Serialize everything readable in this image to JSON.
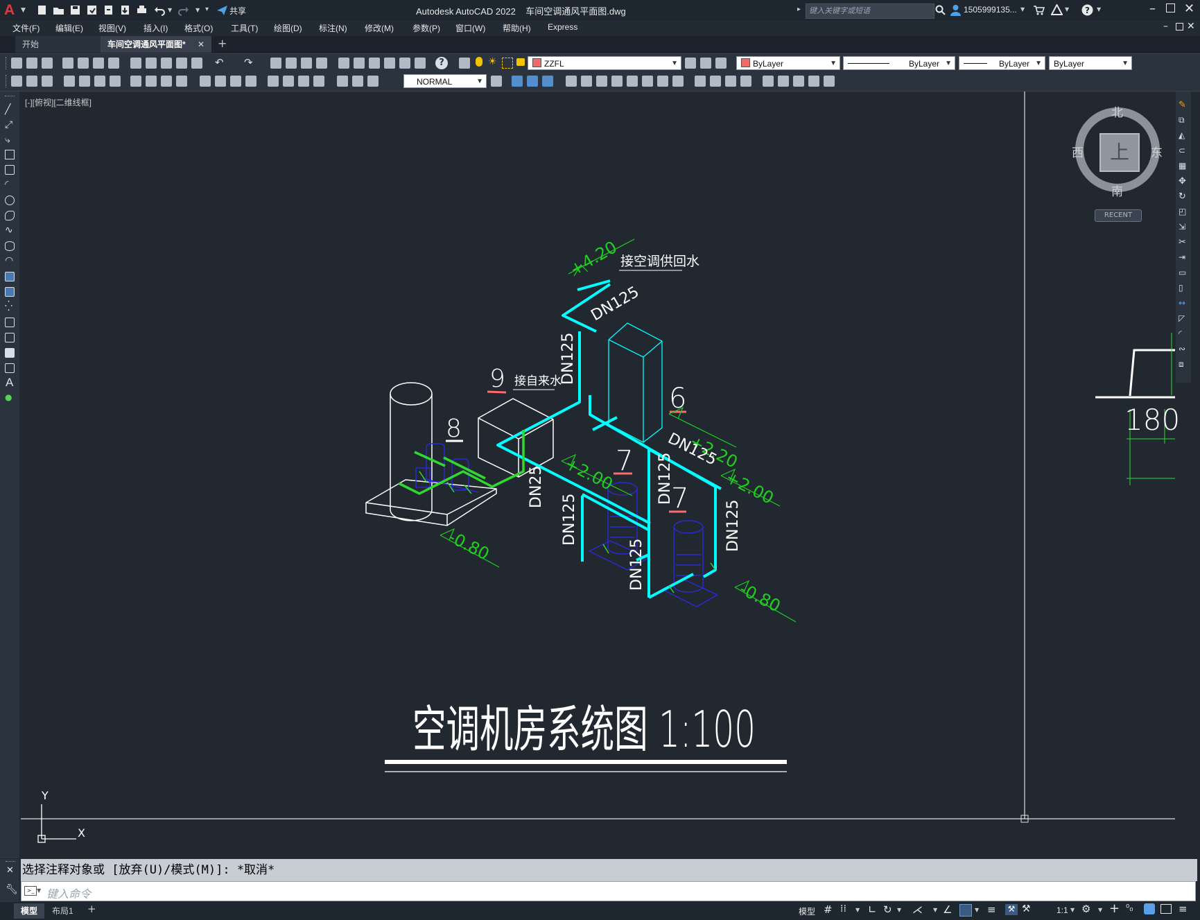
{
  "window": {
    "app_title": "Autodesk AutoCAD 2022    车间空调通风平面图.dwg",
    "share_label": "共享",
    "search_placeholder": "键入关键字或短语",
    "user_name": "1505999135..."
  },
  "menu": [
    "文件(F)",
    "编辑(E)",
    "视图(V)",
    "插入(I)",
    "格式(O)",
    "工具(T)",
    "绘图(D)",
    "标注(N)",
    "修改(M)",
    "参数(P)",
    "窗口(W)",
    "帮助(H)",
    "Express"
  ],
  "tabs": {
    "start": "开始",
    "drawing": "车间空调通风平面图*"
  },
  "toolbar": {
    "layer_name": "ZZFL",
    "color": "ByLayer",
    "linetype": "ByLayer",
    "lineweight": "ByLayer",
    "plotstyle": "ByLayer",
    "dimstyle": "NORMAL"
  },
  "viewport": {
    "label": "[-][俯视][二维线框]"
  },
  "viewcube": {
    "north": "北",
    "south": "南",
    "west": "西",
    "east": "东",
    "top_face": "上",
    "recent": "RECENT"
  },
  "drawing": {
    "title": "空调机房系统图 1:100",
    "note_supply_return": "接空调供回水",
    "note_tap_water": "接自来水",
    "elev_420": "+4.20",
    "elev_220": "+2.20",
    "elev_200_a": "+2.00",
    "elev_200_b": "+2.00",
    "elev_080_a": "-0.80",
    "elev_080_b": "-0.80",
    "dn125": "DN125",
    "dn25": "DN25",
    "tag_9": "9",
    "tag_8": "8",
    "tag_6": "6",
    "tag_7": "7",
    "side_dim": "180",
    "ucs_x": "X",
    "ucs_y": "Y"
  },
  "command": {
    "history": "选择注释对象或 [放弃(U)/模式(M)]: *取消*",
    "input_placeholder": "键入命令"
  },
  "status": {
    "model_tab": "模型",
    "layout_tab": "布局1",
    "model_button": "模型",
    "scale": "1:1"
  },
  "colors": {
    "background": "#212830",
    "pipe_cyan": "#00ffff",
    "pipe_green": "#2fd92f",
    "dim_green": "#1fd01f",
    "equipment_blue": "#2020c8",
    "leader_red": "#ff6a6a",
    "accent_red": "#e8353b"
  }
}
